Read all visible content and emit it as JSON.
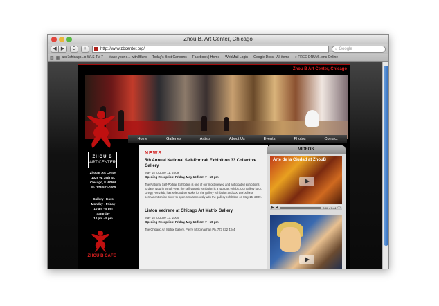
{
  "browser": {
    "window_title": "Zhou B. Art Center, Chicago",
    "nav_back": "◀",
    "nav_forward": "▶",
    "reload": "C",
    "add": "+",
    "url": "http://www.zbcenter.org/",
    "search_placeholder": "Google",
    "bookmarks": [
      "abc7chicago...o WLS-TV 7",
      "Make your o... with Blurb",
      "Today's Best Cartoons",
      "Facebook | Home",
      "WebMail Login",
      "Google Docs - All items",
      "» FREE DRUM...ons Online"
    ]
  },
  "site": {
    "header_title": "Zhou B Art Center, Chicago",
    "nav": [
      "Home",
      "Galleries",
      "Artists",
      "About Us",
      "Events",
      "Photos",
      "Contact"
    ],
    "logo_text_top": "ZHOU B",
    "logo_text_bottom": "ART CENTER",
    "address": [
      "Zhou B Art Center",
      "1029 W. 35th St.",
      "Chicago, IL 60609",
      "Ph. 773-523-0200"
    ],
    "hours": [
      "Gallery Hours",
      "Monday - Friday",
      "10 am - 5 pm",
      "Saturday",
      "10 pm - 5 pm"
    ],
    "cafe": "ZHOU B CAFE"
  },
  "news": {
    "heading": "NEWS",
    "articles": [
      {
        "title": "5th Annual National Self-Portrait Exhibition 33 Collective Gallery",
        "date": "May 15 to June 11, 2009",
        "opening": "Opening Reception: Friday, May 15 from 7 - 10 pm",
        "body": "The National Self-Portrait Exhibition is one of our most viewed and anticipated exhibitions to date. Now in its 5th year, the self-portrait exhibition is a two-part exhibit. Our gallery juror, Gregg Hertzlieb, has selected 50 works for the gallery exhibition and 100 works for a permanent online show to open simultaneously with the gallery exhibition on May 15, 2009."
      },
      {
        "title": "Linton Vedrene at Chicago Art Matrix Gallery",
        "date": "May 15 to June 13, 2009",
        "opening": "Opening Reception: Friday, May 15 from 7 - 10 pm",
        "body": "The Chicago Art Matrix Gallery, Pierre McConaghan Ph. 773 832 4344"
      }
    ],
    "separator": "- - - - - - -"
  },
  "videos": {
    "heading": "VIDEOS",
    "video1_title": "Arte de la Ciudad at ZhouB",
    "video1_time": "0:00 / 7:44"
  },
  "colors": {
    "accent_red": "#d01818",
    "scroll_thumb": "#2f6cbf"
  }
}
